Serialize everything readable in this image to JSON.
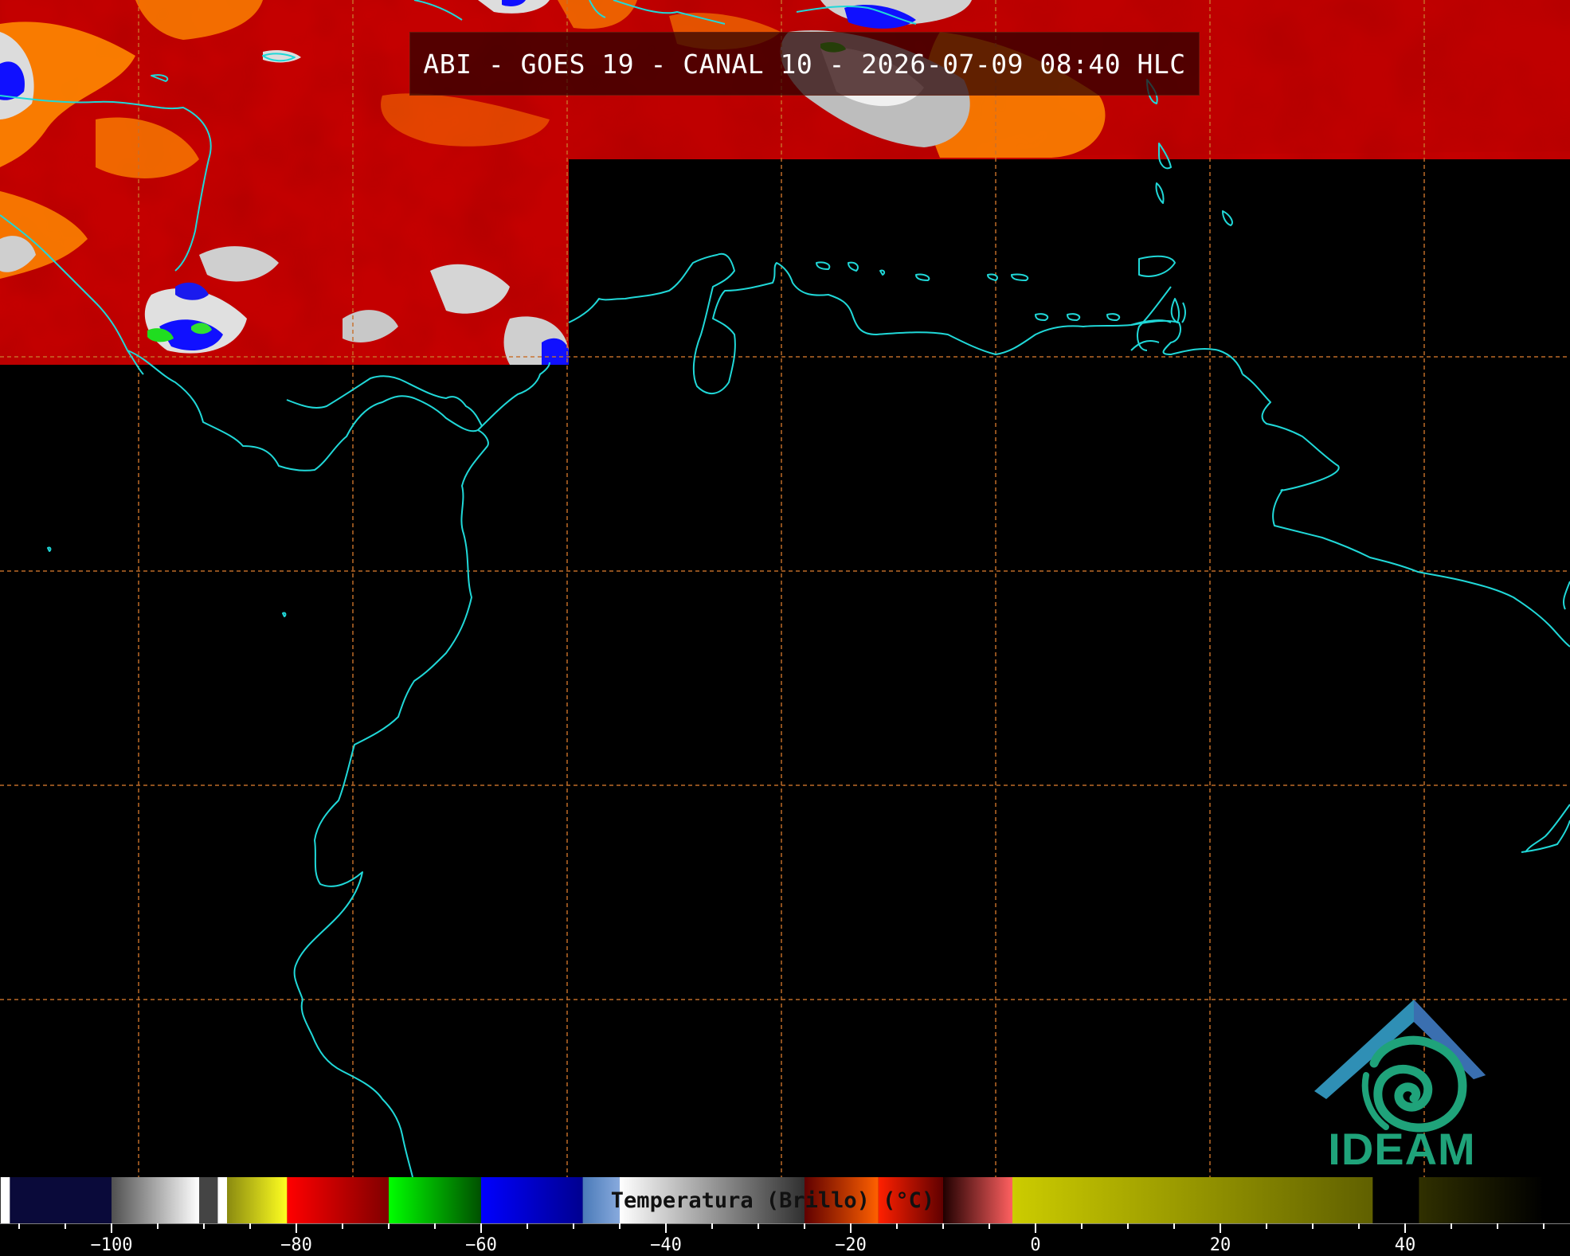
{
  "title": "ABI - GOES 19 - CANAL 10 - 2026-07-09 08:40 HLC",
  "logo": {
    "text": "IDEAM"
  },
  "colorbar": {
    "label": "Temperatura (Brillo) (°C)",
    "min": -112,
    "max": 55,
    "major_ticks": [
      -100,
      -80,
      -60,
      -40,
      -20,
      0,
      20,
      40
    ],
    "segments": [
      {
        "from": -112,
        "to": -111,
        "colors": [
          "#ffffff"
        ]
      },
      {
        "from": -111,
        "to": -100,
        "colors": [
          "#0a0a3a",
          "#0a0a3a"
        ]
      },
      {
        "from": -100,
        "to": -90.5,
        "colors": [
          "#505050",
          "#ffffff"
        ]
      },
      {
        "from": -90.5,
        "to": -88.5,
        "colors": [
          "#444444",
          "#444444"
        ]
      },
      {
        "from": -88.5,
        "to": -87.5,
        "colors": [
          "#ffffff",
          "#ffffff"
        ]
      },
      {
        "from": -87.5,
        "to": -81,
        "colors": [
          "#8a8a10",
          "#ffff20"
        ]
      },
      {
        "from": -81,
        "to": -70,
        "colors": [
          "#ff0000",
          "#800000"
        ]
      },
      {
        "from": -70,
        "to": -60,
        "colors": [
          "#00ff00",
          "#005000"
        ]
      },
      {
        "from": -60,
        "to": -49,
        "colors": [
          "#0000ff",
          "#000090"
        ]
      },
      {
        "from": -49,
        "to": -45,
        "colors": [
          "#4a7ab8",
          "#88aadd"
        ]
      },
      {
        "from": -45,
        "to": -25,
        "colors": [
          "#ffffff",
          "#303030"
        ]
      },
      {
        "from": -25,
        "to": -17,
        "colors": [
          "#600000",
          "#ff6000"
        ]
      },
      {
        "from": -17,
        "to": -10,
        "colors": [
          "#ff2000",
          "#600000"
        ]
      },
      {
        "from": -10,
        "to": -2.5,
        "colors": [
          "#200000",
          "#ff6060"
        ]
      },
      {
        "from": -2.5,
        "to": 36.5,
        "colors": [
          "#cccc00",
          "#606000"
        ]
      },
      {
        "from": 36.5,
        "to": 41.5,
        "colors": [
          "#000000",
          "#000000"
        ]
      },
      {
        "from": 41.5,
        "to": 55,
        "colors": [
          "#303000",
          "#000000"
        ]
      }
    ]
  },
  "map_style": {
    "coastline_color": "#20d8d8",
    "graticule_color": "#c8702a",
    "cloud_colors": [
      "#c80000",
      "#8a0000",
      "#ff8800",
      "#ffffff",
      "#0000ff",
      "#00dd00"
    ]
  }
}
